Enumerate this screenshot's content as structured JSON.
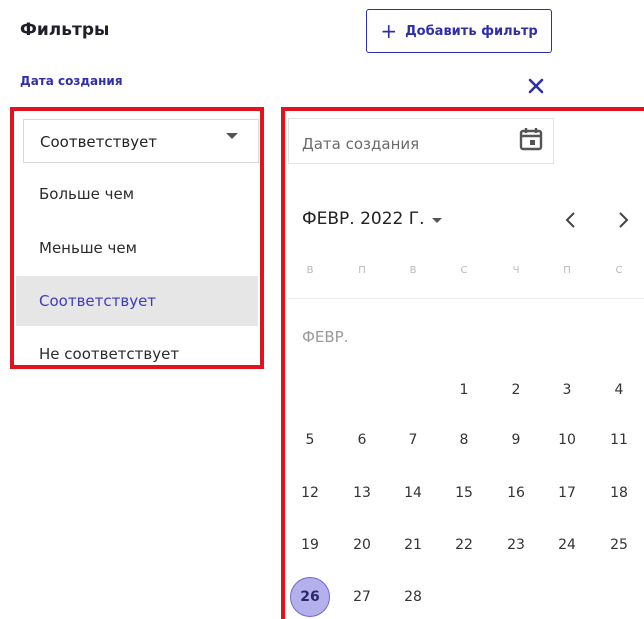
{
  "header": {
    "title": "Фильтры",
    "add_filter_label": "Добавить фильтр",
    "add_filter_icon": "plus-icon",
    "field_label": "Дата создания",
    "close_icon": "close-icon"
  },
  "condition_dropdown": {
    "selected_value": "Соответствует",
    "options": [
      {
        "label": "Больше чем",
        "selected": false
      },
      {
        "label": "Меньше чем",
        "selected": false
      },
      {
        "label": "Соответствует",
        "selected": true
      },
      {
        "label": "Не соответствует",
        "selected": false
      }
    ]
  },
  "date_picker": {
    "placeholder": "Дата создания",
    "calendar_icon": "calendar-icon",
    "month_year": "ФЕВР. 2022 Г.",
    "weekdays": [
      "В",
      "П",
      "В",
      "С",
      "Ч",
      "П",
      "С"
    ],
    "month_section_label": "ФЕВР.",
    "days": [
      1,
      2,
      3,
      4,
      5,
      6,
      7,
      8,
      9,
      10,
      11,
      12,
      13,
      14,
      15,
      16,
      17,
      18,
      19,
      20,
      21,
      22,
      23,
      24,
      25,
      26,
      27,
      28
    ],
    "first_day_column": 3,
    "selected_day": 26
  },
  "colors": {
    "accent": "#2f2fa8",
    "highlight_frame": "#e0141f",
    "selected_day_fill": "#b4b0ec",
    "selected_option_bg": "#e6e6e6"
  }
}
